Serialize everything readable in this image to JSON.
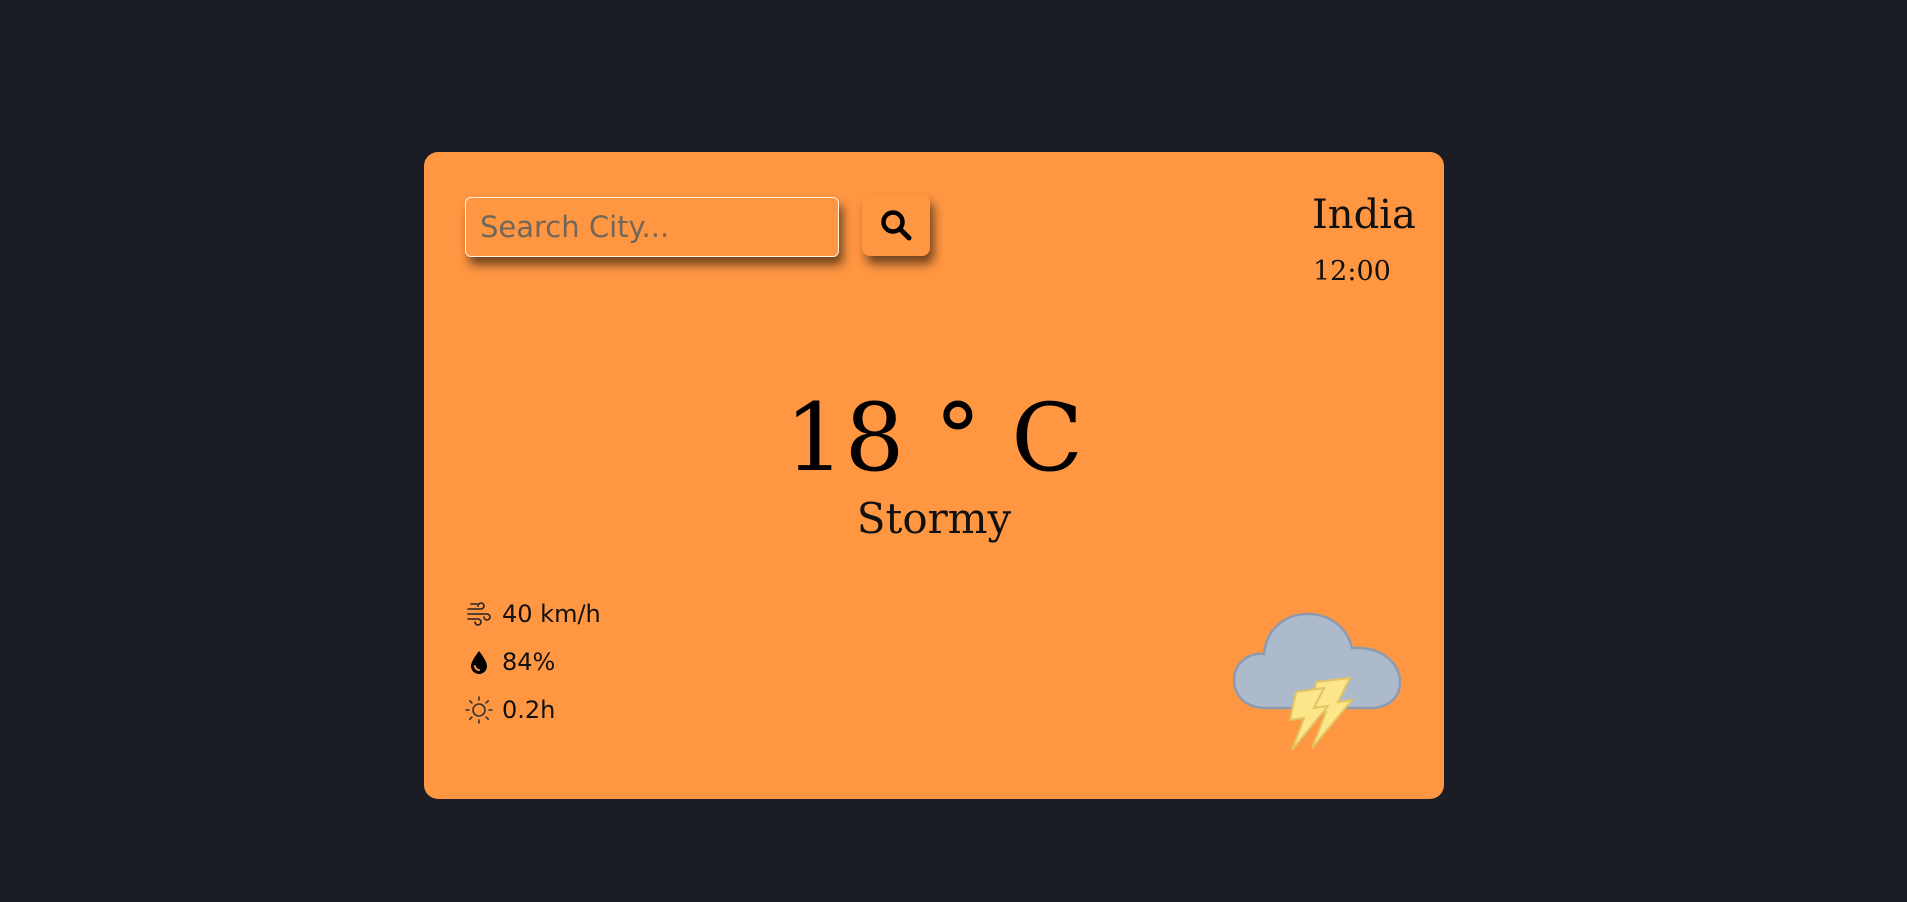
{
  "search": {
    "placeholder": "Search City...",
    "button_icon": "magnifier-icon"
  },
  "location": {
    "name": "India",
    "time": "12:00"
  },
  "current": {
    "temperature": "18 ° C",
    "condition": "Stormy"
  },
  "stats": [
    {
      "icon": "wind-icon",
      "value": "40 km/h"
    },
    {
      "icon": "humidity-drop-icon",
      "value": "84%"
    },
    {
      "icon": "sun-icon",
      "value": "0.2h"
    }
  ],
  "weather_icon": "thunderstorm-cloud-icon",
  "colors": {
    "background": "#1b1d24",
    "card": "#ff9642",
    "text": "#111111"
  }
}
